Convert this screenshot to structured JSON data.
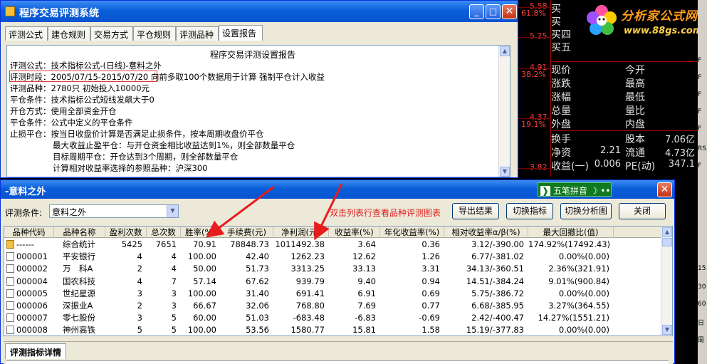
{
  "quote": {
    "levels": [
      {
        "value": "5.58",
        "pct": ""
      },
      {
        "value": "",
        "pct": "61.8%"
      },
      {
        "value": "5.25",
        "pct": ""
      },
      {
        "value": "4.91",
        "pct": "38.2%"
      },
      {
        "value": "4.37",
        "pct": "19.1%"
      },
      {
        "value": "3.82",
        "pct": ""
      }
    ],
    "buy_rows": [
      "买",
      "买",
      "买四",
      "买五"
    ],
    "fields": [
      {
        "l1": "现价",
        "v1": "",
        "l2": "今开",
        "v2": ""
      },
      {
        "l1": "涨跌",
        "v1": "",
        "l2": "最高",
        "v2": ""
      },
      {
        "l1": "涨幅",
        "v1": "",
        "l2": "最低",
        "v2": ""
      },
      {
        "l1": "总量",
        "v1": "",
        "l2": "量比",
        "v2": ""
      },
      {
        "l1": "外盘",
        "v1": "",
        "l2": "内盘",
        "v2": ""
      },
      {
        "l1": "换手",
        "v1": "",
        "l2": "股本",
        "v2": "7.06亿"
      },
      {
        "l1": "净资",
        "v1": "2.21",
        "l2": "流通",
        "v2": "4.73亿"
      },
      {
        "l1": "收益(一)",
        "v1": "0.006",
        "l2": "PE(动)",
        "v2": "347.1"
      }
    ]
  },
  "logo": {
    "brand": "分析家公式网",
    "url": "www.88gs.com"
  },
  "right_strip": [
    "F",
    "F",
    "F",
    "F",
    "F",
    "RS",
    "F",
    "15",
    "30",
    "60",
    "日",
    "周"
  ],
  "dialog1": {
    "title": "程序交易评测系统",
    "tabs": [
      "评测公式",
      "建仓规则",
      "交易方式",
      "平仓规则",
      "评测品种",
      "设置报告"
    ],
    "active_tab": 5,
    "report_title": "程序交易评测设置报告",
    "report_lines": [
      "评测公式：技术指标公式-(日线)-意料之外",
      "评测时段：2005/07/15-2015/07/20 向前多取100个数据用于计算 强制平仓计入收益",
      "评测品种：2780只 初始投入10000元",
      "平仓条件：技术指标公式短线发飙大于0",
      "开仓方式：使用全部资金开仓",
      "平仓条件：公式中定义的平仓条件",
      "止损平仓：按当日收盘价计算是否满足止损条件，按本周期收盘价平仓",
      "最大收益止盈平仓：与开仓资金相比收益达到1%，则全部数量平仓",
      "目标周期平仓：开仓达到3个周期，则全部数量平仓",
      "计算相对收益率选择的参照品种：沪深300"
    ],
    "win_buttons": {
      "min": "_",
      "max": "□",
      "close": "✕"
    }
  },
  "dialog2": {
    "title": "-意料之外",
    "ime_label": "五笔拼音",
    "condition_label": "评测条件:",
    "condition_value": "意料之外",
    "hint": "双击列表行查看品种评测图表",
    "buttons": [
      "导出结果",
      "切换指标",
      "切换分析图",
      "关闭"
    ],
    "columns": [
      "品种代码",
      "品种名称",
      "盈利次数",
      "总次数",
      "胜率(%)",
      "手续费(元)",
      "净利润(元)",
      "收益率(%)",
      "年化收益率(%)",
      "相对收益率α/β(%)",
      "最大回撤比(值)"
    ],
    "rows": [
      [
        "------",
        "综合统计",
        "5425",
        "7651",
        "70.91",
        "78848.73",
        "1011492.38",
        "3.64",
        "0.36",
        "3.12/-390.00",
        "174.92%(17492.43)"
      ],
      [
        "000001",
        "平安银行",
        "4",
        "4",
        "100.00",
        "42.40",
        "1262.23",
        "12.62",
        "1.26",
        "6.77/-381.02",
        "0.00%(0.00)"
      ],
      [
        "000002",
        "万　科A",
        "2",
        "4",
        "50.00",
        "51.73",
        "3313.25",
        "33.13",
        "3.31",
        "34.13/-360.51",
        "2.36%(321.91)"
      ],
      [
        "000004",
        "国农科技",
        "4",
        "7",
        "57.14",
        "67.62",
        "939.79",
        "9.40",
        "0.94",
        "14.51/-384.24",
        "9.01%(900.84)"
      ],
      [
        "000005",
        "世纪星源",
        "3",
        "3",
        "100.00",
        "31.40",
        "691.41",
        "6.91",
        "0.69",
        "5.75/-386.72",
        "0.00%(0.00)"
      ],
      [
        "000006",
        "深振业A",
        "2",
        "3",
        "66.67",
        "32.06",
        "768.80",
        "7.69",
        "0.77",
        "6.68/-385.95",
        "3.27%(364.55)"
      ],
      [
        "000007",
        "零七股份",
        "3",
        "5",
        "60.00",
        "51.03",
        "-683.48",
        "-6.83",
        "-0.69",
        "2.42/-400.47",
        "14.27%(1551.21)"
      ],
      [
        "000008",
        "神州高铁",
        "5",
        "5",
        "100.00",
        "53.56",
        "1580.77",
        "15.81",
        "1.58",
        "15.19/-377.83",
        "0.00%(0.00)"
      ]
    ],
    "detail_tab": "评测指标详情",
    "close_glyph": "✕"
  }
}
